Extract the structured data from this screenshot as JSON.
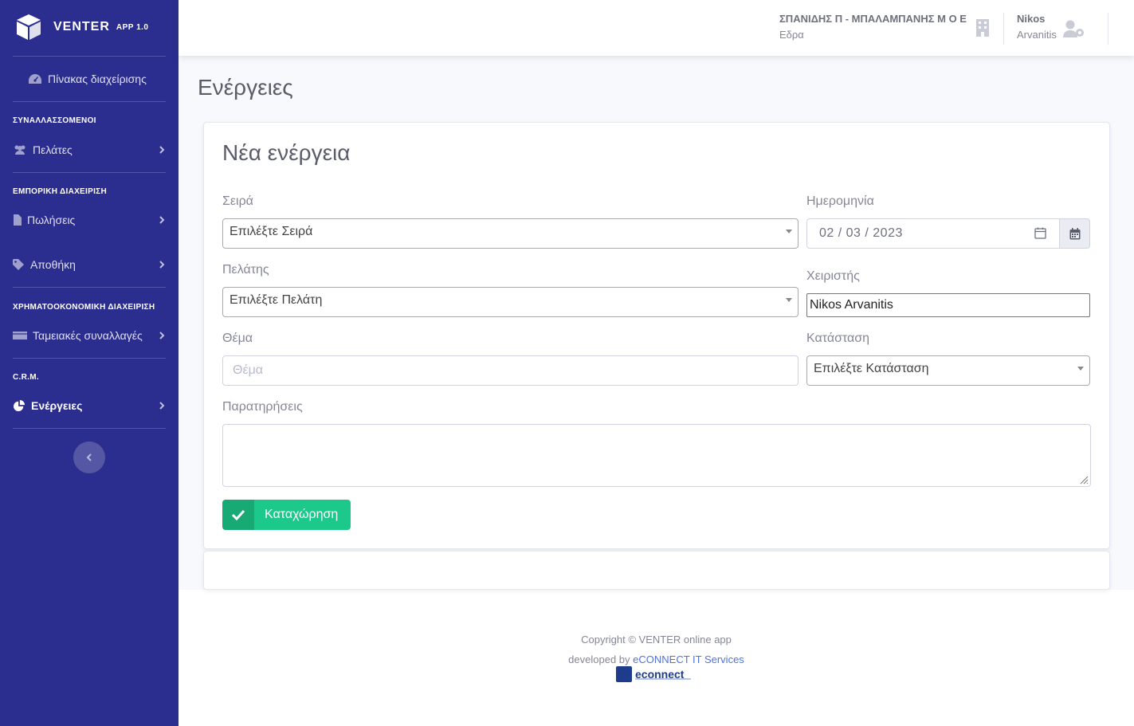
{
  "app": {
    "brand_name": "VENTER",
    "brand_version": "APP 1.0"
  },
  "sidebar": {
    "dashboard_label": "Πίνακας διαχείρισης",
    "sections": [
      {
        "heading": "ΣΥΝΑΛΛΑΣΣΟΜΕΝΟΙ"
      },
      {
        "heading": "ΕΜΠΟΡΙΚΗ ΔΙΑΧΕΙΡΙΣΗ"
      },
      {
        "heading": "ΧΡΗΜΑΤΟΟΚΟΝΟΜΙΚΗ ΔΙΑΧΕΙΡΙΣΗ"
      },
      {
        "heading": "C.R.M."
      }
    ],
    "items": [
      {
        "label": "Πελάτες",
        "icon": "users-icon"
      },
      {
        "label": "Πωλήσεις",
        "icon": "file-icon"
      },
      {
        "label": "Αποθήκη",
        "icon": "tag-icon"
      },
      {
        "label": "Ταμειακές συναλλαγές",
        "icon": "money-icon"
      },
      {
        "label": "Ενέργειες",
        "icon": "pie-chart-icon",
        "active": true
      }
    ]
  },
  "topbar": {
    "company_name": "ΣΠΑΝΙΔΗΣ Π - ΜΠΑΛΑΜΠΑΝΗΣ Μ Ο Ε",
    "company_branch": "Εδρα",
    "user_first": "Nikos",
    "user_last": "Arvanitis"
  },
  "page": {
    "title": "Ενέργειες"
  },
  "form": {
    "title": "Νέα ενέργεια",
    "series_label": "Σειρά",
    "series_value": "Επιλέξτε Σειρά",
    "date_label": "Ημερομηνία",
    "date_value": "02 / 03 / 2023",
    "customer_label": "Πελάτης",
    "customer_value": "Επιλέξτε Πελάτη",
    "handler_label": "Χειριστής",
    "handler_value": "Nikos Arvanitis",
    "subject_label": "Θέμα",
    "subject_placeholder": "Θέμα",
    "status_label": "Κατάσταση",
    "status_value": "Επιλέξτε Κατάσταση",
    "notes_label": "Παρατηρήσεις",
    "submit_label": "Καταχώρηση"
  },
  "footer": {
    "copyright": "Copyright © VENTER online app",
    "developed_by": "developed by",
    "developer_link": "eCONNECT IT Services",
    "logo_text": "econnect"
  },
  "colors": {
    "sidebar_bg": "#2b2e8e",
    "success": "#1cc88a",
    "link": "#4e73df"
  }
}
